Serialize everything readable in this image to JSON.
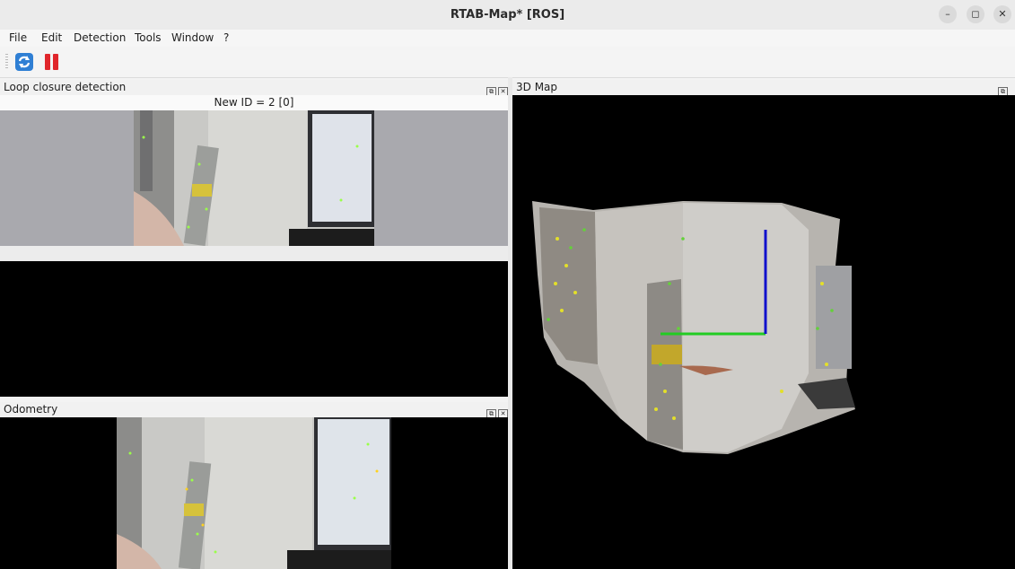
{
  "window": {
    "title": "RTAB-Map* [ROS]",
    "controls": [
      "–",
      "◻",
      "✕"
    ]
  },
  "menu": [
    "File",
    "Edit",
    "Detection",
    "Tools",
    "Window",
    "?"
  ],
  "toolbar": {
    "icons": [
      "refresh-icon",
      "pause-icon"
    ],
    "colors": {
      "refresh": "#2f7fd4",
      "pause": "#e0262b"
    }
  },
  "loop_closure": {
    "title": "Loop closure detection",
    "subtitle": "New ID = 2 [0]"
  },
  "odometry": {
    "title": "Odometry"
  },
  "map3d": {
    "title": "3D Map",
    "axes_colors": {
      "x": "#22cc22",
      "z": "#1010cc"
    }
  },
  "dock_buttons": {
    "float": "⧉",
    "close": "✕"
  }
}
